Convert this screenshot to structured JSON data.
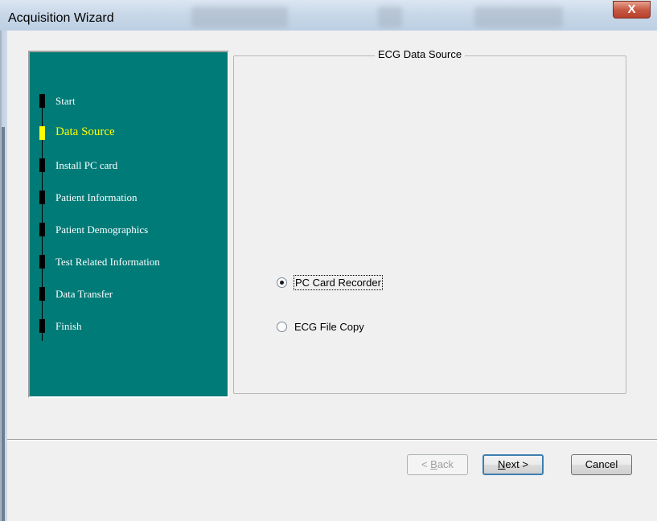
{
  "window": {
    "title": "Acquisition Wizard",
    "close_symbol": "X"
  },
  "steps": {
    "items": [
      {
        "label": "Start",
        "active": false
      },
      {
        "label": "Data Source",
        "active": true
      },
      {
        "label": "Install PC card",
        "active": false
      },
      {
        "label": "Patient Information",
        "active": false
      },
      {
        "label": "Patient Demographics",
        "active": false
      },
      {
        "label": "Test Related Information",
        "active": false
      },
      {
        "label": "Data Transfer",
        "active": false
      },
      {
        "label": "Finish",
        "active": false
      }
    ]
  },
  "data_source": {
    "title": "ECG Data Source",
    "options": [
      {
        "label": "PC Card Recorder",
        "checked": true,
        "focused": true
      },
      {
        "label": "ECG File Copy",
        "checked": false,
        "focused": false
      }
    ]
  },
  "buttons": {
    "back": {
      "prefix": "< ",
      "mnemonic": "B",
      "rest": "ack",
      "enabled": false
    },
    "next": {
      "mnemonic": "N",
      "rest": "ext >",
      "enabled": true,
      "default": true
    },
    "cancel": {
      "label": "Cancel",
      "enabled": true
    }
  },
  "colors": {
    "panel": "#007b78",
    "active_step": "#ffff00",
    "step_text": "#ffffff",
    "default_button_border": "#3c7fb1"
  }
}
